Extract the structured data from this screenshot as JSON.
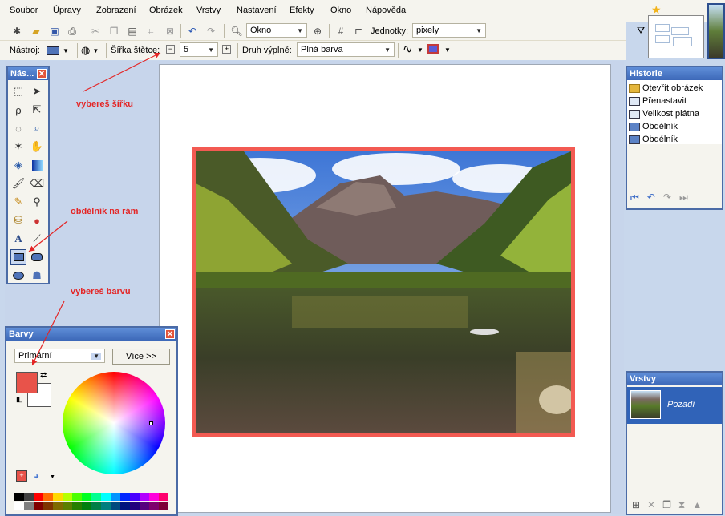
{
  "menu": [
    "Soubor",
    "Úpravy",
    "Zobrazení",
    "Obrázek",
    "Vrstvy",
    "Nastavení",
    "Efekty",
    "Okno",
    "Nápověda"
  ],
  "toolbar": {
    "zoom_value": "Okno",
    "units_label": "Jednotky:",
    "units_value": "pixely"
  },
  "toolbar2": {
    "tool_label": "Nástroj:",
    "brush_width_label": "Šířka štětce:",
    "brush_width_value": "5",
    "fill_label": "Druh výplně:",
    "fill_value": "Plná barva"
  },
  "tools_panel": {
    "title": "Nás..."
  },
  "colors_panel": {
    "title": "Barvy",
    "mode_value": "Primární",
    "more_button": "Více >>",
    "primary_color": "#e8534a",
    "secondary_color": "#ffffff"
  },
  "history_panel": {
    "title": "Historie",
    "items": [
      "Otevřít obrázek",
      "Přenastavit",
      "Velikost plátna",
      "Obdélník",
      "Obdélník"
    ]
  },
  "layers_panel": {
    "title": "Vrstvy",
    "layer_name": "Pozadí"
  },
  "annotations": {
    "width": "vybereš šířku",
    "rect": "obdélník na rám",
    "color": "vybereš barvu"
  },
  "palette": {
    "row1": [
      "#000000",
      "#404040",
      "#ff0000",
      "#ff6a00",
      "#ffd800",
      "#b6ff00",
      "#4cff00",
      "#00ff21",
      "#00ff90",
      "#00ffff",
      "#0094ff",
      "#0026ff",
      "#4800ff",
      "#b200ff",
      "#ff00dc",
      "#ff006e"
    ],
    "row2": [
      "#ffffff",
      "#808080",
      "#7f0000",
      "#7f3300",
      "#7f6a00",
      "#5b7f00",
      "#267f00",
      "#007f0e",
      "#007f46",
      "#007f7f",
      "#004a7f",
      "#00137f",
      "#21007f",
      "#57007f",
      "#7f006e",
      "#7f0037"
    ]
  }
}
